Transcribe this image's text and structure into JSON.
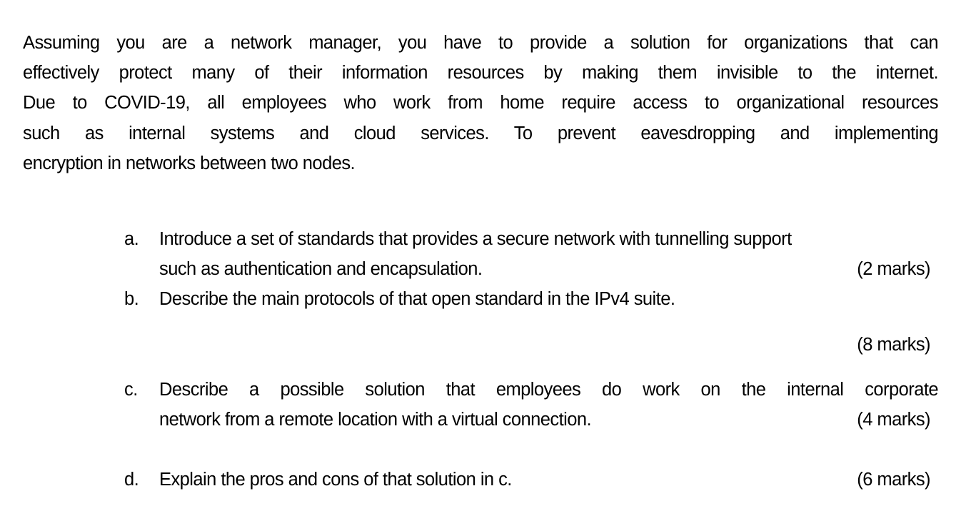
{
  "document": {
    "intro_lines": [
      "Assuming you are a network manager, you have to provide a solution for organizations that can",
      "effectively protect many of their information resources by making them invisible to the internet.",
      "Due to COVID-19, all employees who work from home require access to organizational resources",
      "such as internal systems and cloud services.  To prevent eavesdropping and implementing",
      "encryption in networks between two nodes."
    ],
    "questions": [
      {
        "label": "a.",
        "lines": [
          "Introduce a set of standards that provides a secure network with tunnelling support",
          "such as authentication and encapsulation."
        ],
        "marks": "(2 marks)"
      },
      {
        "label": "b.",
        "lines": [
          "Describe the main protocols of that open standard in the IPv4 suite."
        ],
        "marks": "(8 marks)"
      },
      {
        "label": "c.",
        "lines": [
          "Describe a possible solution that employees do work on the internal corporate",
          "network from a remote location with a virtual connection."
        ],
        "marks": "(4 marks)"
      },
      {
        "label": "d.",
        "lines": [
          "Explain the pros and cons of that solution in c."
        ],
        "marks": "(6 marks)"
      }
    ]
  }
}
